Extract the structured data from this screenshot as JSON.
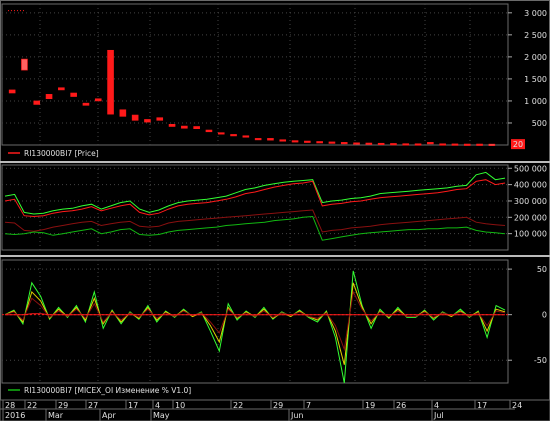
{
  "colors": {
    "background": "#000000",
    "frame": "#6a6a6a",
    "grid": "#444444",
    "price": "#ff1a1a",
    "green": "#12b812",
    "green_bright": "#33ff33",
    "darkred": "#8a1010",
    "yellow": "#e0d000",
    "current_badge": "#ff1a1a"
  },
  "chart_data": [
    {
      "type": "bar",
      "name_label": "RI130000BI7 [Price]",
      "ylim": [
        0,
        3200
      ],
      "y_ticks": [
        {
          "v": 3000,
          "label": "3 000"
        },
        {
          "v": 2500,
          "label": "2 500"
        },
        {
          "v": 2000,
          "label": "2 000"
        },
        {
          "v": 1500,
          "label": "1 500"
        },
        {
          "v": 1000,
          "label": "1 000"
        },
        {
          "v": 500,
          "label": "500"
        }
      ],
      "current_value_label": "20",
      "current_value": 20,
      "candles": [
        {
          "o": 1250,
          "c": 1180
        },
        {
          "o": 1700,
          "c": 1950
        },
        {
          "o": 1000,
          "c": 920
        },
        {
          "o": 1150,
          "c": 1050
        },
        {
          "o": 1300,
          "c": 1250
        },
        {
          "o": 1180,
          "c": 1100
        },
        {
          "o": 950,
          "c": 900
        },
        {
          "o": 1050,
          "c": 1000
        },
        {
          "o": 2150,
          "c": 700
        },
        {
          "o": 800,
          "c": 650
        },
        {
          "o": 680,
          "c": 560
        },
        {
          "o": 580,
          "c": 520
        },
        {
          "o": 620,
          "c": 560
        },
        {
          "o": 470,
          "c": 420
        },
        {
          "o": 430,
          "c": 380
        },
        {
          "o": 420,
          "c": 370
        },
        {
          "o": 340,
          "c": 300
        },
        {
          "o": 280,
          "c": 250
        },
        {
          "o": 240,
          "c": 210
        },
        {
          "o": 210,
          "c": 180
        },
        {
          "o": 150,
          "c": 120
        },
        {
          "o": 150,
          "c": 110
        },
        {
          "o": 120,
          "c": 90
        },
        {
          "o": 100,
          "c": 80
        },
        {
          "o": 90,
          "c": 70
        },
        {
          "o": 80,
          "c": 60
        },
        {
          "o": 70,
          "c": 55
        },
        {
          "o": 60,
          "c": 45
        },
        {
          "o": 50,
          "c": 40
        },
        {
          "o": 45,
          "c": 35
        },
        {
          "o": 40,
          "c": 30
        },
        {
          "o": 35,
          "c": 28
        },
        {
          "o": 30,
          "c": 25
        },
        {
          "o": 28,
          "c": 22
        },
        {
          "o": 60,
          "c": 25
        },
        {
          "o": 28,
          "c": 22
        },
        {
          "o": 25,
          "c": 20
        },
        {
          "o": 22,
          "c": 20
        },
        {
          "o": 22,
          "c": 20
        },
        {
          "o": 20,
          "c": 20
        }
      ],
      "stray_marker": 3050
    },
    {
      "type": "line",
      "ylim": [
        0,
        520000
      ],
      "y_ticks": [
        {
          "v": 500000,
          "label": "500 000"
        },
        {
          "v": 400000,
          "label": "400 000"
        },
        {
          "v": 300000,
          "label": "300 000"
        },
        {
          "v": 200000,
          "label": "200 000"
        },
        {
          "v": 100000,
          "label": "100 000"
        }
      ],
      "series": [
        {
          "color_key": "green_bright",
          "values": [
            330000,
            340000,
            230000,
            220000,
            225000,
            240000,
            250000,
            255000,
            270000,
            280000,
            250000,
            270000,
            290000,
            300000,
            250000,
            230000,
            245000,
            270000,
            290000,
            300000,
            305000,
            310000,
            320000,
            330000,
            350000,
            370000,
            380000,
            395000,
            405000,
            415000,
            420000,
            425000,
            430000,
            290000,
            300000,
            305000,
            315000,
            320000,
            330000,
            345000,
            350000,
            355000,
            360000,
            365000,
            370000,
            375000,
            380000,
            390000,
            395000,
            460000,
            475000,
            430000,
            440000
          ]
        },
        {
          "color_key": "price",
          "values": [
            300000,
            310000,
            210000,
            205000,
            210000,
            225000,
            235000,
            240000,
            250000,
            265000,
            240000,
            255000,
            270000,
            280000,
            230000,
            215000,
            225000,
            250000,
            270000,
            280000,
            285000,
            290000,
            300000,
            310000,
            325000,
            345000,
            355000,
            370000,
            385000,
            395000,
            405000,
            410000,
            420000,
            270000,
            280000,
            285000,
            295000,
            300000,
            310000,
            320000,
            325000,
            330000,
            335000,
            340000,
            345000,
            350000,
            360000,
            370000,
            375000,
            420000,
            430000,
            400000,
            410000
          ]
        },
        {
          "color_key": "darkred",
          "values": [
            170000,
            165000,
            120000,
            115000,
            125000,
            140000,
            150000,
            160000,
            170000,
            175000,
            150000,
            160000,
            170000,
            175000,
            145000,
            140000,
            145000,
            165000,
            175000,
            180000,
            185000,
            190000,
            195000,
            200000,
            205000,
            210000,
            215000,
            220000,
            225000,
            230000,
            235000,
            240000,
            245000,
            110000,
            120000,
            125000,
            135000,
            140000,
            145000,
            155000,
            160000,
            165000,
            170000,
            175000,
            180000,
            185000,
            190000,
            195000,
            200000,
            170000,
            160000,
            155000,
            150000
          ]
        },
        {
          "color_key": "green",
          "values": [
            100000,
            95000,
            100000,
            110000,
            105000,
            90000,
            100000,
            110000,
            120000,
            130000,
            100000,
            110000,
            125000,
            130000,
            95000,
            90000,
            95000,
            110000,
            120000,
            125000,
            130000,
            135000,
            140000,
            150000,
            155000,
            160000,
            165000,
            170000,
            180000,
            185000,
            190000,
            200000,
            205000,
            60000,
            70000,
            80000,
            90000,
            100000,
            105000,
            110000,
            115000,
            120000,
            125000,
            125000,
            130000,
            130000,
            135000,
            135000,
            140000,
            120000,
            110000,
            105000,
            100000
          ]
        }
      ]
    },
    {
      "type": "line",
      "name_label": "RI130000BI7 [MICEX_OI Изменение % V1.0]",
      "ylim": [
        -75,
        60
      ],
      "y_ticks": [
        {
          "v": 50,
          "label": "50"
        },
        {
          "v": 0,
          "label": "0"
        },
        {
          "v": -50,
          "label": "-50"
        }
      ],
      "series": [
        {
          "color_key": "green_bright",
          "values": [
            0,
            5,
            -10,
            35,
            20,
            -5,
            8,
            -3,
            10,
            -8,
            25,
            -15,
            5,
            -10,
            3,
            -5,
            10,
            -8,
            4,
            -3,
            6,
            -2,
            3,
            -18,
            -40,
            12,
            -6,
            4,
            -3,
            8,
            -5,
            3,
            -2,
            5,
            -3,
            -8,
            4,
            -25,
            -75,
            48,
            10,
            -15,
            6,
            -4,
            8,
            -3,
            -3,
            5,
            -6,
            3,
            -2,
            6,
            -3,
            4,
            -25,
            10,
            5
          ]
        },
        {
          "color_key": "yellow",
          "values": [
            0,
            4,
            -8,
            25,
            15,
            -4,
            6,
            -2,
            8,
            -6,
            18,
            -10,
            4,
            -8,
            2,
            -4,
            8,
            -6,
            3,
            -2,
            5,
            -2,
            2,
            -12,
            -30,
            8,
            -4,
            3,
            -2,
            6,
            -4,
            2,
            -2,
            4,
            -2,
            -6,
            3,
            -18,
            -55,
            35,
            8,
            -10,
            4,
            -3,
            6,
            -2,
            -2,
            4,
            -4,
            2,
            -2,
            4,
            -2,
            3,
            -18,
            6,
            3
          ]
        },
        {
          "color_key": "darkred",
          "values": [
            0,
            3,
            -6,
            18,
            10,
            -3,
            4,
            -2,
            6,
            -4,
            12,
            -8,
            3,
            -6,
            2,
            -3,
            6,
            -4,
            2,
            -2,
            4,
            -1,
            2,
            -8,
            -20,
            6,
            -3,
            2,
            -2,
            4,
            -3,
            2,
            -1,
            3,
            -2,
            -4,
            2,
            -12,
            -38,
            25,
            6,
            -7,
            3,
            -2,
            4,
            -2,
            -2,
            3,
            -3,
            2,
            -1,
            3,
            -2,
            2,
            -12,
            4,
            2
          ]
        },
        {
          "color_key": "price",
          "values": [
            0,
            0,
            0,
            1,
            1,
            0,
            0,
            0,
            0,
            0,
            0,
            0,
            0,
            0,
            0,
            0,
            0,
            0,
            0,
            0,
            0,
            0,
            0,
            0,
            0,
            0,
            0,
            0,
            0,
            0,
            0,
            0,
            0,
            0,
            0,
            0,
            0,
            0,
            0,
            0,
            0,
            0,
            0,
            0,
            0,
            0,
            0,
            0,
            0,
            0,
            0,
            0,
            0,
            0,
            0,
            0,
            0
          ]
        }
      ]
    }
  ],
  "x_axis": {
    "day_labels": [
      "28",
      "22",
      "29",
      "27",
      "17",
      "4",
      "10",
      "22",
      "29",
      "7",
      "19",
      "26",
      "4",
      "17",
      "24"
    ],
    "month_labels": [
      "2016",
      "Mar",
      "Apr",
      "May",
      "Jun",
      "Jul"
    ]
  }
}
